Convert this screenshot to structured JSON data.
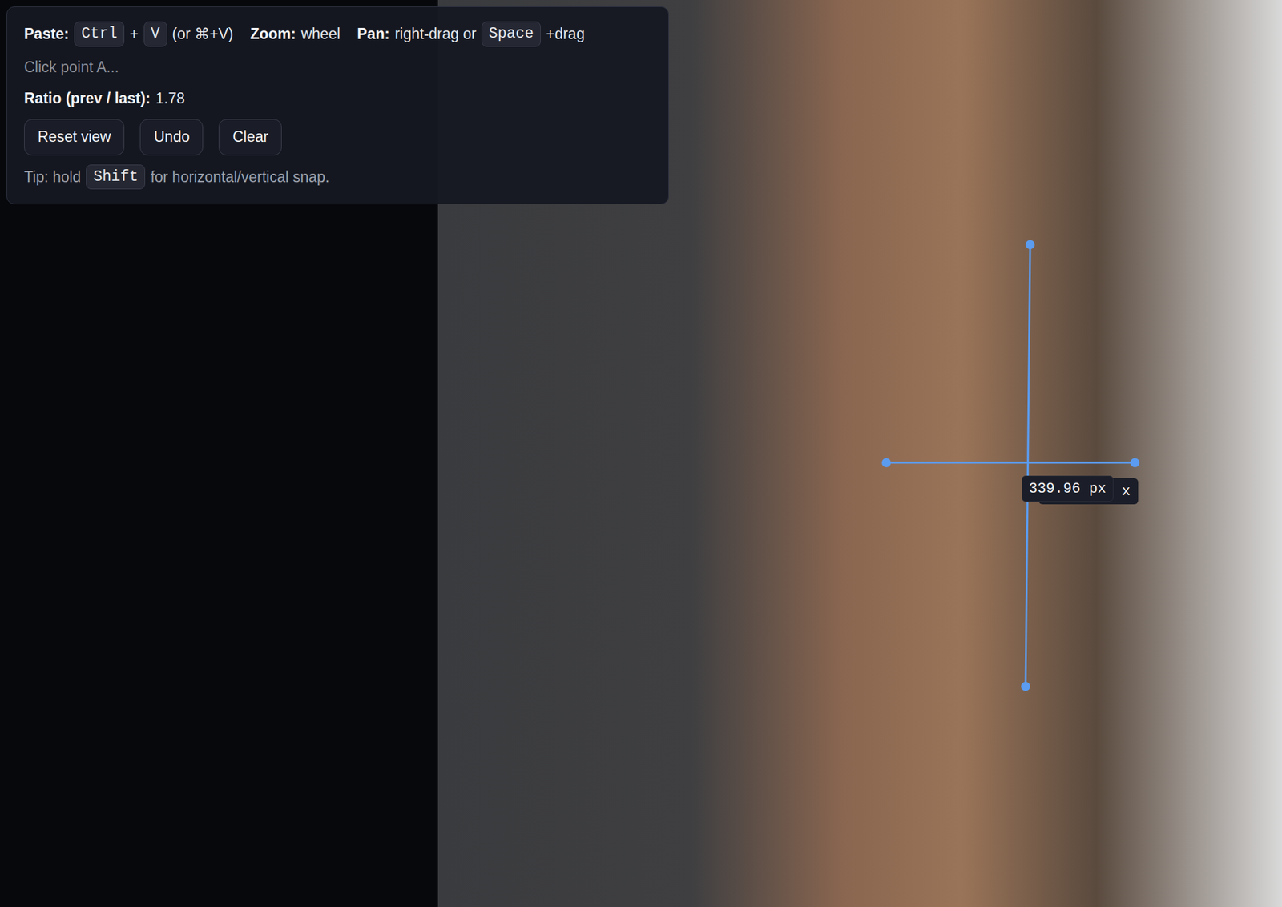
{
  "toolbar": {
    "hints": [
      {
        "kind": "label",
        "text": "Paste:"
      },
      {
        "kind": "key",
        "text": "Ctrl"
      },
      {
        "kind": "text",
        "text": "+"
      },
      {
        "kind": "key",
        "text": "V"
      },
      {
        "kind": "text",
        "text": "(or ⌘+V)"
      },
      {
        "kind": "label",
        "text": "Zoom:"
      },
      {
        "kind": "text",
        "text": "wheel"
      },
      {
        "kind": "label",
        "text": "Pan:"
      },
      {
        "kind": "text",
        "text": "right-drag or"
      },
      {
        "kind": "key",
        "text": "Space"
      },
      {
        "kind": "text",
        "text": "+drag"
      }
    ],
    "status": "Click point A...",
    "ratio": {
      "label": "Ratio (prev / last):",
      "value": "1.78"
    },
    "buttons": [
      "Reset view",
      "Undo",
      "Clear"
    ],
    "tip": [
      {
        "kind": "text",
        "text": "Tip: hold"
      },
      {
        "kind": "key",
        "text": "Shift"
      },
      {
        "kind": "text",
        "text": "for horizontal/vertical snap."
      }
    ]
  },
  "canvas": {
    "measurements": [
      {
        "label": "x",
        "covered": true
      },
      {
        "label": "339.96 px",
        "covered": false
      }
    ]
  }
}
